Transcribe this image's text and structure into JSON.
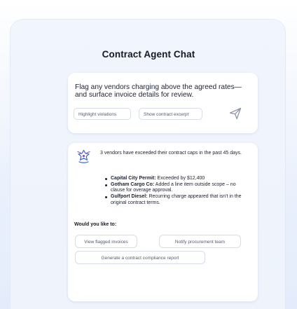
{
  "page": {
    "title": "Contract Agent Chat"
  },
  "prompt": {
    "text": "Flag any vendors charging above the agreed rates—and surface invoice details for review.",
    "chips": [
      {
        "label": "Highlight violations"
      },
      {
        "label": "Show contract excerpt"
      }
    ],
    "send_icon": "send-icon"
  },
  "response": {
    "agent_icon": "agent-logo-icon",
    "summary": "3 vendors have exceeded their contract caps in the past 45 days.",
    "vendors": [
      {
        "name": "Capital City Permit:",
        "detail": " Exceeded by $12,400"
      },
      {
        "name": "Gotham Cargo Co:",
        "detail": " Added a line item outside scope – no clause for overage approval."
      },
      {
        "name": "Gulfport Diesel:",
        "detail": " Recurring charge appeared that isn't in the original contract terms."
      }
    ],
    "question": "Would you like to:",
    "actions": [
      {
        "label": "View flagged invoices"
      },
      {
        "label": "Notify procurement team"
      },
      {
        "label": "Generate a contract compliance report"
      }
    ]
  },
  "colors": {
    "background": "#eef3fd",
    "card": "#f1f5fd",
    "panel": "#ffffff",
    "text": "#1c1f2a",
    "muted": "#555c70",
    "border": "#d7dceb",
    "icon": "#8e95aa",
    "accent_blue": "#3a63d8",
    "accent_purple": "#8a4bd6"
  }
}
